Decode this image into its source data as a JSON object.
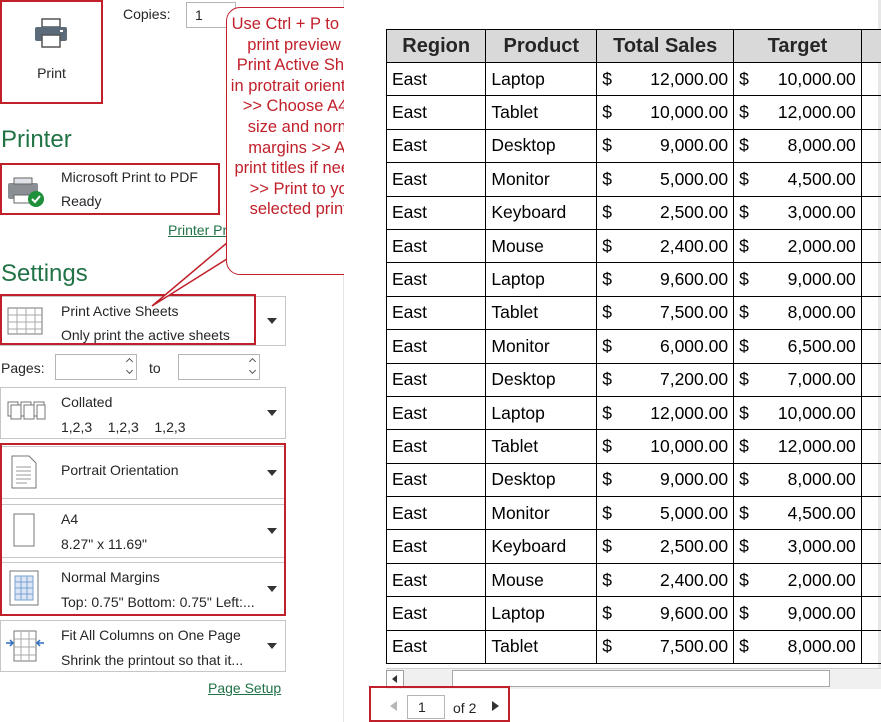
{
  "print_button": {
    "label": "Print"
  },
  "copies": {
    "label": "Copies:",
    "value": "1"
  },
  "printer": {
    "heading": "Printer",
    "name": "Microsoft Print to PDF",
    "status": "Ready",
    "properties_link": "Printer Properties"
  },
  "settings": {
    "heading": "Settings",
    "active_sheets": {
      "title": "Print Active Sheets",
      "subtitle": "Only print the active sheets"
    },
    "pages": {
      "label": "Pages:",
      "to_label": "to",
      "from_value": "",
      "to_value": ""
    },
    "collated": {
      "title": "Collated",
      "subtitle": "1,2,3    1,2,3    1,2,3"
    },
    "orientation": {
      "title": "Portrait Orientation"
    },
    "paper": {
      "title": "A4",
      "subtitle": "8.27\" x 11.69\""
    },
    "margins": {
      "title": "Normal Margins",
      "subtitle": "Top: 0.75\" Bottom: 0.75\" Left:..."
    },
    "scaling": {
      "title": "Fit All Columns on One Page",
      "subtitle": "Shrink the printout so that it..."
    },
    "page_setup_link": "Page Setup"
  },
  "callout": {
    "text": "Use Ctrl + P to open print preview >> Print Active Sheets in protrait orientation >> Choose A4 as size and normal margins >> Add print titles if needed >> Print to your selected printer"
  },
  "preview": {
    "headers": [
      "Region",
      "Product",
      "Total Sales",
      "Target"
    ],
    "currency": "$",
    "rows": [
      {
        "region": "East",
        "product": "Laptop",
        "sales": "12,000.00",
        "target": "10,000.00"
      },
      {
        "region": "East",
        "product": "Tablet",
        "sales": "10,000.00",
        "target": "12,000.00"
      },
      {
        "region": "East",
        "product": "Desktop",
        "sales": "9,000.00",
        "target": "8,000.00"
      },
      {
        "region": "East",
        "product": "Monitor",
        "sales": "5,000.00",
        "target": "4,500.00"
      },
      {
        "region": "East",
        "product": "Keyboard",
        "sales": "2,500.00",
        "target": "3,000.00"
      },
      {
        "region": "East",
        "product": "Mouse",
        "sales": "2,400.00",
        "target": "2,000.00"
      },
      {
        "region": "East",
        "product": "Laptop",
        "sales": "9,600.00",
        "target": "9,000.00"
      },
      {
        "region": "East",
        "product": "Tablet",
        "sales": "7,500.00",
        "target": "8,000.00"
      },
      {
        "region": "East",
        "product": "Monitor",
        "sales": "6,000.00",
        "target": "6,500.00"
      },
      {
        "region": "East",
        "product": "Desktop",
        "sales": "7,200.00",
        "target": "7,000.00"
      },
      {
        "region": "East",
        "product": "Laptop",
        "sales": "12,000.00",
        "target": "10,000.00"
      },
      {
        "region": "East",
        "product": "Tablet",
        "sales": "10,000.00",
        "target": "12,000.00"
      },
      {
        "region": "East",
        "product": "Desktop",
        "sales": "9,000.00",
        "target": "8,000.00"
      },
      {
        "region": "East",
        "product": "Monitor",
        "sales": "5,000.00",
        "target": "4,500.00"
      },
      {
        "region": "East",
        "product": "Keyboard",
        "sales": "2,500.00",
        "target": "3,000.00"
      },
      {
        "region": "East",
        "product": "Mouse",
        "sales": "2,400.00",
        "target": "2,000.00"
      },
      {
        "region": "East",
        "product": "Laptop",
        "sales": "9,600.00",
        "target": "9,000.00"
      },
      {
        "region": "East",
        "product": "Tablet",
        "sales": "7,500.00",
        "target": "8,000.00"
      }
    ]
  },
  "pager": {
    "current": "1",
    "of_label": "of 2"
  },
  "colors": {
    "accent_green": "#217346",
    "highlight_red": "#c0202a",
    "header_gray": "#d9d9d9"
  }
}
